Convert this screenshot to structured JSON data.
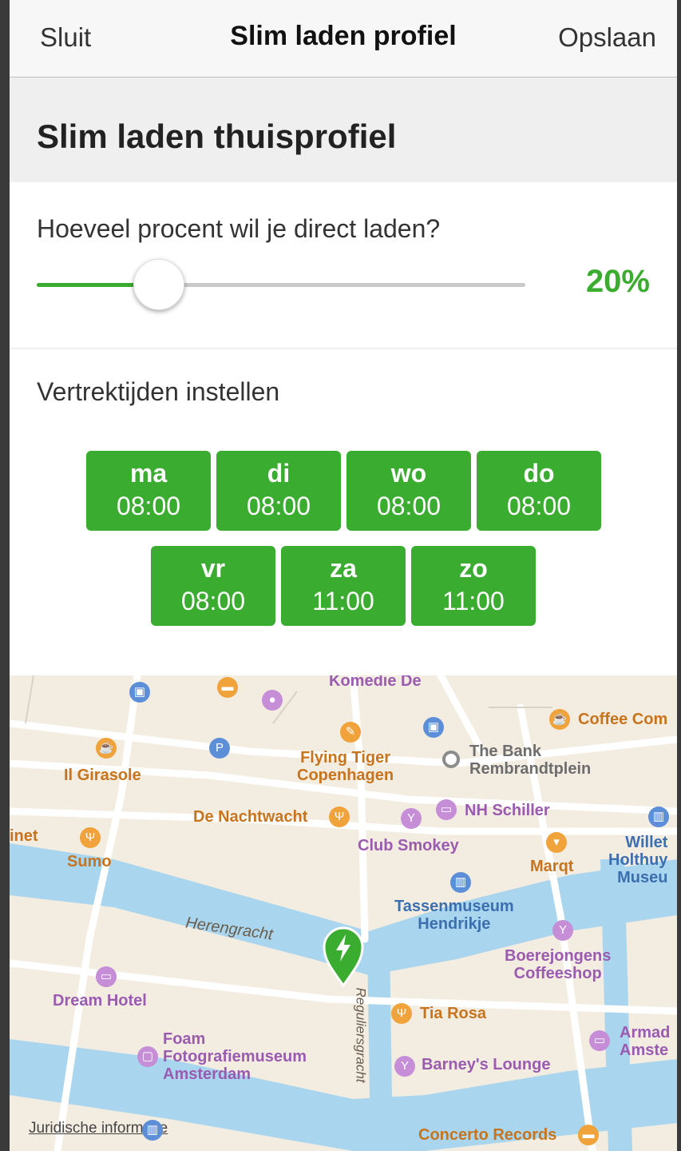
{
  "nav": {
    "left": "Sluit",
    "title": "Slim laden profiel",
    "right": "Opslaan"
  },
  "section": {
    "title": "Slim laden thuisprofiel"
  },
  "charge": {
    "question": "Hoeveel procent wil je direct laden?",
    "value_label": "20%",
    "value_fraction": 0.2
  },
  "departure": {
    "label": "Vertrektijden instellen",
    "days": [
      {
        "day": "ma",
        "time": "08:00"
      },
      {
        "day": "di",
        "time": "08:00"
      },
      {
        "day": "wo",
        "time": "08:00"
      },
      {
        "day": "do",
        "time": "08:00"
      },
      {
        "day": "vr",
        "time": "08:00"
      },
      {
        "day": "za",
        "time": "11:00"
      },
      {
        "day": "zo",
        "time": "11:00"
      }
    ]
  },
  "map": {
    "places": {
      "komedie": "Komedie De",
      "coffee": "Coffee Com",
      "bank": "The Bank\nRembrandtplein",
      "flying_tiger": "Flying Tiger\nCopenhagen",
      "girasole": "Il Girasole",
      "nachtwacht": "De Nachtwacht",
      "nh_schiller": "NH Schiller",
      "inet": "inet",
      "sumo": "Sumo",
      "club_smokey": "Club Smokey",
      "marqt": "Marqt",
      "willet": "Willet\nHolthuy\nMuseu",
      "tassenmuseum": "Tassenmuseum\nHendrikje",
      "herengracht": "Herengracht",
      "boerejongens": "Boerejongens\nCoffeeshop",
      "dream_hotel": "Dream Hotel",
      "tia_rosa": "Tia Rosa",
      "reguliersgracht": "Reguliersgracht",
      "foam": "Foam\nFotografiemuseum\nAmsterdam",
      "armada": "Armad\nAmste",
      "barneys": "Barney's Lounge",
      "concerto": "Concerto Records"
    },
    "legal": "Juridische informatie"
  },
  "colors": {
    "accent": "#3aac2f",
    "map_water": "#a9d6ee",
    "map_land": "#f3ece1"
  }
}
